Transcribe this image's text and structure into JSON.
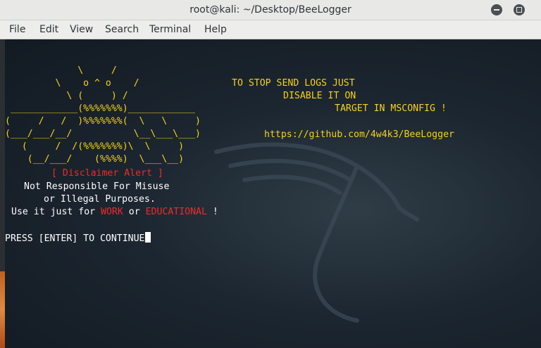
{
  "window": {
    "title": "root@kali: ~/Desktop/BeeLogger"
  },
  "menubar": {
    "items": [
      "File",
      "Edit",
      "View",
      "Search",
      "Terminal",
      "Help"
    ]
  },
  "terminal": {
    "ascii_art": [
      "             \\     /",
      "         \\    o ^ o    /",
      "           \\ (     ) /",
      " ____________(%%%%%%%)____________",
      "(     /   /  )%%%%%%%(  \\   \\     )",
      "(___/___/__/           \\__\\___\\___)",
      "   (     /  /(%%%%%%%)\\  \\     )",
      "    (__/___/    (%%%%)  \\___\\__)"
    ],
    "info_lines": [
      "TO STOP SEND LOGS JUST",
      "DISABLE IT ON",
      "TARGET IN MSCONFIG !"
    ],
    "repo_url": "https://github.com/4w4k3/BeeLogger",
    "disclaimer_title": "[ Disclaimer Alert ]",
    "disclaimer_line1": "Not Responsible For Misuse",
    "disclaimer_line2": "or Illegal Purposes.",
    "use_prefix": "Use it just for ",
    "use_work": "WORK",
    "use_or": " or ",
    "use_edu": "EDUCATIONAL",
    "use_suffix": " !",
    "prompt": "PRESS [ENTER] TO CONTINUE"
  },
  "colors": {
    "ascii": "#f6d21b",
    "alert": "#ef2b2b",
    "text": "#ffffff"
  }
}
